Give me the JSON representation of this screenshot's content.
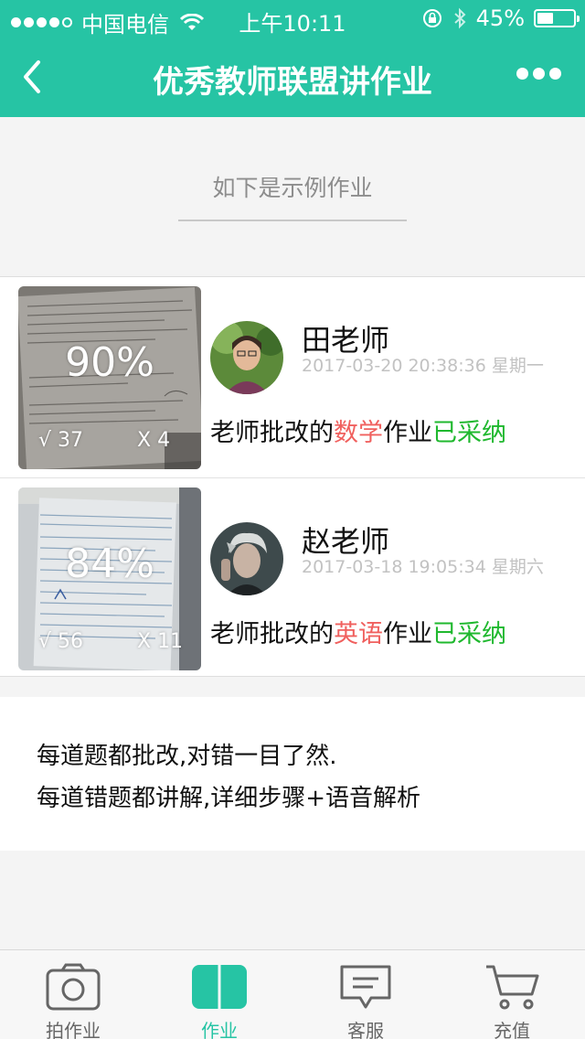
{
  "status_bar": {
    "carrier": "中国电信",
    "time": "上午10:11",
    "battery": "45%",
    "battery_level": 0.45
  },
  "header": {
    "title": "优秀教师联盟讲作业",
    "back_icon": "chevron-left-icon",
    "more_icon": "more-dots-icon"
  },
  "notice": {
    "text": "如下是示例作业"
  },
  "homework_list": [
    {
      "score": "90%",
      "correct": "√ 37",
      "wrong": "X 4",
      "teacher": "田老师",
      "datetime": "2017-03-20 20:38:36 星期一",
      "desc_prefix": "老师批改的",
      "subject": "数学",
      "desc_middle": "作业",
      "status": "已采纳"
    },
    {
      "score": "84%",
      "correct": "√ 56",
      "wrong": "X 11",
      "teacher": "赵老师",
      "datetime": "2017-03-18 19:05:34 星期六",
      "desc_prefix": "老师批改的",
      "subject": "英语",
      "desc_middle": "作业",
      "status": "已采纳"
    }
  ],
  "info": {
    "line1": "每道题都批改,对错一目了然.",
    "line2": "每道错题都讲解,详细步骤+语音解析"
  },
  "tabs": [
    {
      "label": "拍作业",
      "icon": "camera-icon"
    },
    {
      "label": "作业",
      "icon": "book-icon",
      "active": true
    },
    {
      "label": "客服",
      "icon": "chat-icon"
    },
    {
      "label": "充值",
      "icon": "cart-icon"
    }
  ],
  "colors": {
    "brand": "#26c4a4",
    "subject": "#f0605e",
    "accepted": "#1fb82e"
  }
}
